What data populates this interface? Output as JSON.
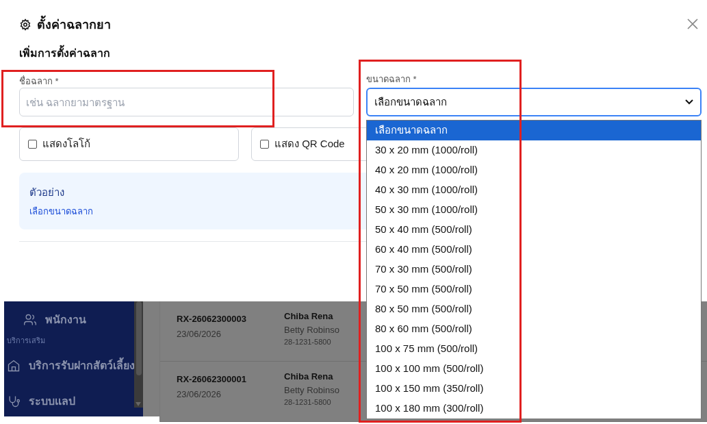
{
  "dialog": {
    "title": "ตั้งค่าฉลากยา",
    "section_title": "เพิ่มการตั้งค่าฉลาก",
    "name_field": {
      "label": "ชื่อฉลาก *",
      "placeholder": "เช่น ฉลากยามาตรฐาน"
    },
    "size_field": {
      "label": "ขนาดฉลาก *",
      "value": "เลือกขนาดฉลาก",
      "expanded": true,
      "options": [
        {
          "label": "เลือกขนาดฉลาก",
          "selected": true
        },
        {
          "label": "30 x 20 mm (1000/roll)",
          "selected": false
        },
        {
          "label": "40 x 20 mm (1000/roll)",
          "selected": false
        },
        {
          "label": "40 x 30 mm (1000/roll)",
          "selected": false
        },
        {
          "label": "50 x 30 mm (1000/roll)",
          "selected": false
        },
        {
          "label": "50 x 40 mm (500/roll)",
          "selected": false
        },
        {
          "label": "60 x 40 mm (500/roll)",
          "selected": false
        },
        {
          "label": "70 x 30 mm (500/roll)",
          "selected": false
        },
        {
          "label": "70 x 50 mm (500/roll)",
          "selected": false
        },
        {
          "label": "80 x 50 mm (500/roll)",
          "selected": false
        },
        {
          "label": "80 x 60 mm (500/roll)",
          "selected": false
        },
        {
          "label": "100 x 75 mm (500/roll)",
          "selected": false
        },
        {
          "label": "100 x 100 mm (500/roll)",
          "selected": false
        },
        {
          "label": "100 x 150 mm (350/roll)",
          "selected": false
        },
        {
          "label": "100 x 180 mm (300/roll)",
          "selected": false
        }
      ]
    },
    "options": [
      {
        "label": "แสดงโลโก้",
        "checked": false
      },
      {
        "label": "แสดง QR Code",
        "checked": false
      }
    ],
    "preview": {
      "title": "ตัวอย่าง",
      "text": "เลือกขนาดฉลาก"
    }
  },
  "sidebar": {
    "items": [
      {
        "kind": "item",
        "label": "พนักงาน"
      },
      {
        "kind": "section",
        "label": "บริการเสริม"
      },
      {
        "kind": "item",
        "label": "บริการรับฝากสัตว์เลี้ยง"
      },
      {
        "kind": "item",
        "label": "ระบบแลป"
      }
    ]
  },
  "prescriptions": [
    {
      "number": "RX-26062300003",
      "date": "23/06/2026",
      "patient": "Chiba Rena",
      "owner": "Betty Robinso",
      "phone": "28-1231-5800"
    },
    {
      "number": "RX-26062300001",
      "date": "23/06/2026",
      "patient": "Chiba Rena",
      "owner": "Betty Robinso",
      "phone": "28-1231-5800"
    }
  ]
}
